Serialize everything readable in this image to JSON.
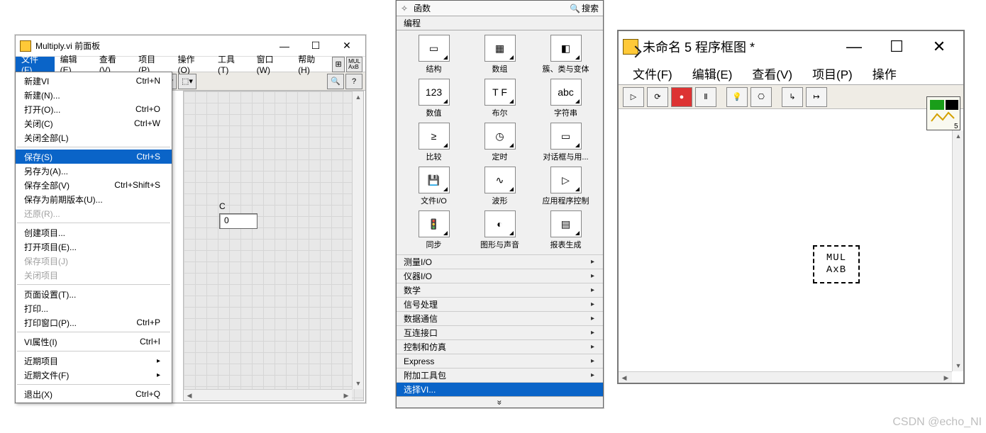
{
  "watermark": "CSDN @echo_NI",
  "win1": {
    "title": "Multiply.vi 前面板",
    "menubar": [
      "文件(F)",
      "编辑(E)",
      "查看(V)",
      "项目(P)",
      "操作(O)",
      "工具(T)",
      "窗口(W)",
      "帮助(H)"
    ],
    "dropdown": [
      {
        "label": "新建VI",
        "shortcut": "Ctrl+N"
      },
      {
        "label": "新建(N)...",
        "shortcut": ""
      },
      {
        "label": "打开(O)...",
        "shortcut": "Ctrl+O"
      },
      {
        "label": "关闭(C)",
        "shortcut": "Ctrl+W"
      },
      {
        "label": "关闭全部(L)",
        "shortcut": ""
      },
      {
        "sep": true
      },
      {
        "label": "保存(S)",
        "shortcut": "Ctrl+S",
        "highlight": true
      },
      {
        "label": "另存为(A)...",
        "shortcut": ""
      },
      {
        "label": "保存全部(V)",
        "shortcut": "Ctrl+Shift+S"
      },
      {
        "label": "保存为前期版本(U)...",
        "shortcut": ""
      },
      {
        "label": "还原(R)...",
        "shortcut": "",
        "disabled": true
      },
      {
        "sep": true
      },
      {
        "label": "创建项目...",
        "shortcut": ""
      },
      {
        "label": "打开项目(E)...",
        "shortcut": ""
      },
      {
        "label": "保存项目(J)",
        "shortcut": "",
        "disabled": true
      },
      {
        "label": "关闭项目",
        "shortcut": "",
        "disabled": true
      },
      {
        "sep": true
      },
      {
        "label": "页面设置(T)...",
        "shortcut": ""
      },
      {
        "label": "打印...",
        "shortcut": ""
      },
      {
        "label": "打印窗口(P)...",
        "shortcut": "Ctrl+P"
      },
      {
        "sep": true
      },
      {
        "label": "VI属性(I)",
        "shortcut": "Ctrl+I"
      },
      {
        "sep": true
      },
      {
        "label": "近期项目",
        "shortcut": "",
        "sub": true
      },
      {
        "label": "近期文件(F)",
        "shortcut": "",
        "sub": true
      },
      {
        "sep": true
      },
      {
        "label": "退出(X)",
        "shortcut": "Ctrl+Q"
      }
    ],
    "control": {
      "label": "C",
      "value": "0"
    }
  },
  "win2": {
    "header_title": "函数",
    "search_label": "搜索",
    "section": "编程",
    "grid": [
      {
        "name": "结构",
        "icon": "structure"
      },
      {
        "name": "数组",
        "icon": "array"
      },
      {
        "name": "簇、类与变体",
        "icon": "cluster"
      },
      {
        "name": "数值",
        "icon": "numeric"
      },
      {
        "name": "布尔",
        "icon": "boolean"
      },
      {
        "name": "字符串",
        "icon": "string"
      },
      {
        "name": "比较",
        "icon": "compare"
      },
      {
        "name": "定时",
        "icon": "timing"
      },
      {
        "name": "对话框与用...",
        "icon": "dialog"
      },
      {
        "name": "文件I/O",
        "icon": "fileio"
      },
      {
        "name": "波形",
        "icon": "waveform"
      },
      {
        "name": "应用程序控制",
        "icon": "appctrl"
      },
      {
        "name": "同步",
        "icon": "sync"
      },
      {
        "name": "图形与声音",
        "icon": "graphics"
      },
      {
        "name": "报表生成",
        "icon": "report"
      }
    ],
    "list": [
      {
        "label": "测量I/O"
      },
      {
        "label": "仪器I/O"
      },
      {
        "label": "数学"
      },
      {
        "label": "信号处理"
      },
      {
        "label": "数据通信"
      },
      {
        "label": "互连接口"
      },
      {
        "label": "控制和仿真"
      },
      {
        "label": "Express"
      },
      {
        "label": "附加工具包"
      },
      {
        "label": "选择VI...",
        "highlight": true
      }
    ],
    "footer_glyph": "»"
  },
  "win3": {
    "title": "未命名 5 程序框图 *",
    "menubar": [
      "文件(F)",
      "编辑(E)",
      "查看(V)",
      "项目(P)",
      "操作"
    ],
    "subvi": {
      "line1": "MUL",
      "line2": "AxB"
    }
  }
}
